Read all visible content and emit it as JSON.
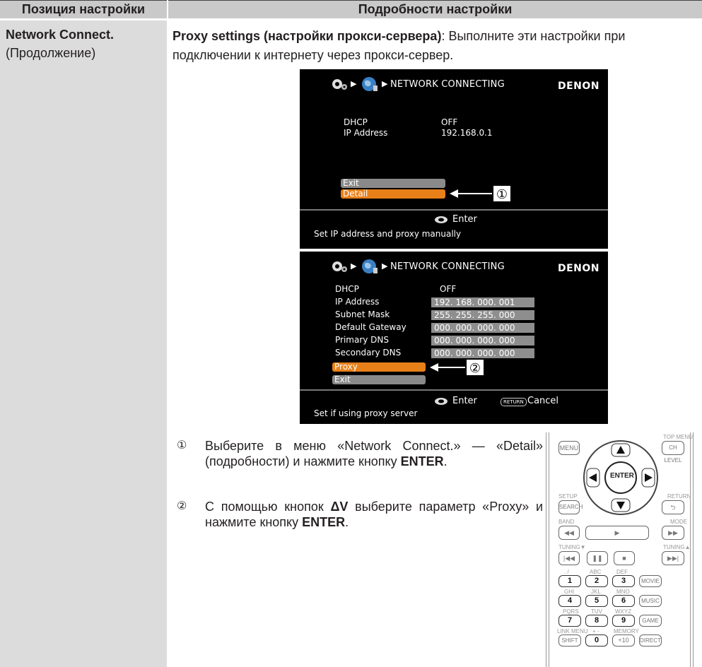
{
  "header": {
    "col1": "Позиция настройки",
    "col2": "Подробности настройки"
  },
  "left": {
    "title": "Network Connect.",
    "subtitle": "(Продолжение)"
  },
  "intro": {
    "bold": "Proxy settings (настройки прокси-сервера)",
    "rest": ": Выполните эти настройки при подключении к интернету через прокси-сервер."
  },
  "screen1": {
    "title": "NETWORK CONNECTING",
    "brand": "DENON",
    "dhcp_label": "DHCP",
    "dhcp_value": "OFF",
    "ip_label": "IP Address",
    "ip_value": "192.168.0.1",
    "exit": "Exit",
    "detail": "Detail",
    "enter": "Enter",
    "hint": "Set IP address and proxy manually",
    "callout": "①"
  },
  "screen2": {
    "title": "NETWORK CONNECTING",
    "brand": "DENON",
    "rows": [
      {
        "label": "DHCP",
        "value": "OFF"
      },
      {
        "label": "IP Address",
        "value": "192. 168. 000. 001"
      },
      {
        "label": "Subnet Mask",
        "value": "255. 255. 255. 000"
      },
      {
        "label": "Default Gateway",
        "value": "000. 000. 000. 000"
      },
      {
        "label": "Primary DNS",
        "value": "000. 000. 000. 000"
      },
      {
        "label": "Secondary DNS",
        "value": "000. 000. 000. 000"
      }
    ],
    "proxy": "Proxy",
    "exit": "Exit",
    "enter": "Enter",
    "return_key": "RETURN",
    "cancel": "Cancel",
    "hint": "Set if using proxy server",
    "callout": "②"
  },
  "steps": [
    {
      "num": "①",
      "pre": "Выберите в меню «Network Connect.» — «Detail» (подробности) и нажмите кнопку ",
      "key": "ENTER",
      "post": "."
    },
    {
      "num": "②",
      "pre": "С помощью кнопок ",
      "arrows": "ΔV",
      "mid": " выберите параметр «Proxy» и нажмите кнопку ",
      "key": "ENTER",
      "post": "."
    }
  ],
  "remote": {
    "top_menu": "TOP MENU",
    "menu": "MENU",
    "ch_level": "CH LEVEL",
    "enter": "ENTER",
    "setup": "SETUP",
    "search": "SEARCH",
    "return_lbl": "RETURN",
    "band": "BAND",
    "mode": "MODE",
    "tuning_down": "TUNING▼",
    "tuning_up": "TUNING▲",
    "digits": [
      "1",
      "2",
      "3",
      "4",
      "5",
      "6",
      "7",
      "8",
      "9",
      "0"
    ],
    "letters": [
      ". /",
      "ABC",
      "DEF",
      "GHI",
      "JKL",
      "MNO",
      "PQRS",
      "TUV",
      "WXYZ",
      "LINK MENU",
      "+ -",
      "MEMORY"
    ],
    "movie": "MOVIE",
    "music": "MUSIC",
    "game": "GAME",
    "shift": "SHIFT",
    "plus10": "+10",
    "direct": "DIRECT"
  }
}
